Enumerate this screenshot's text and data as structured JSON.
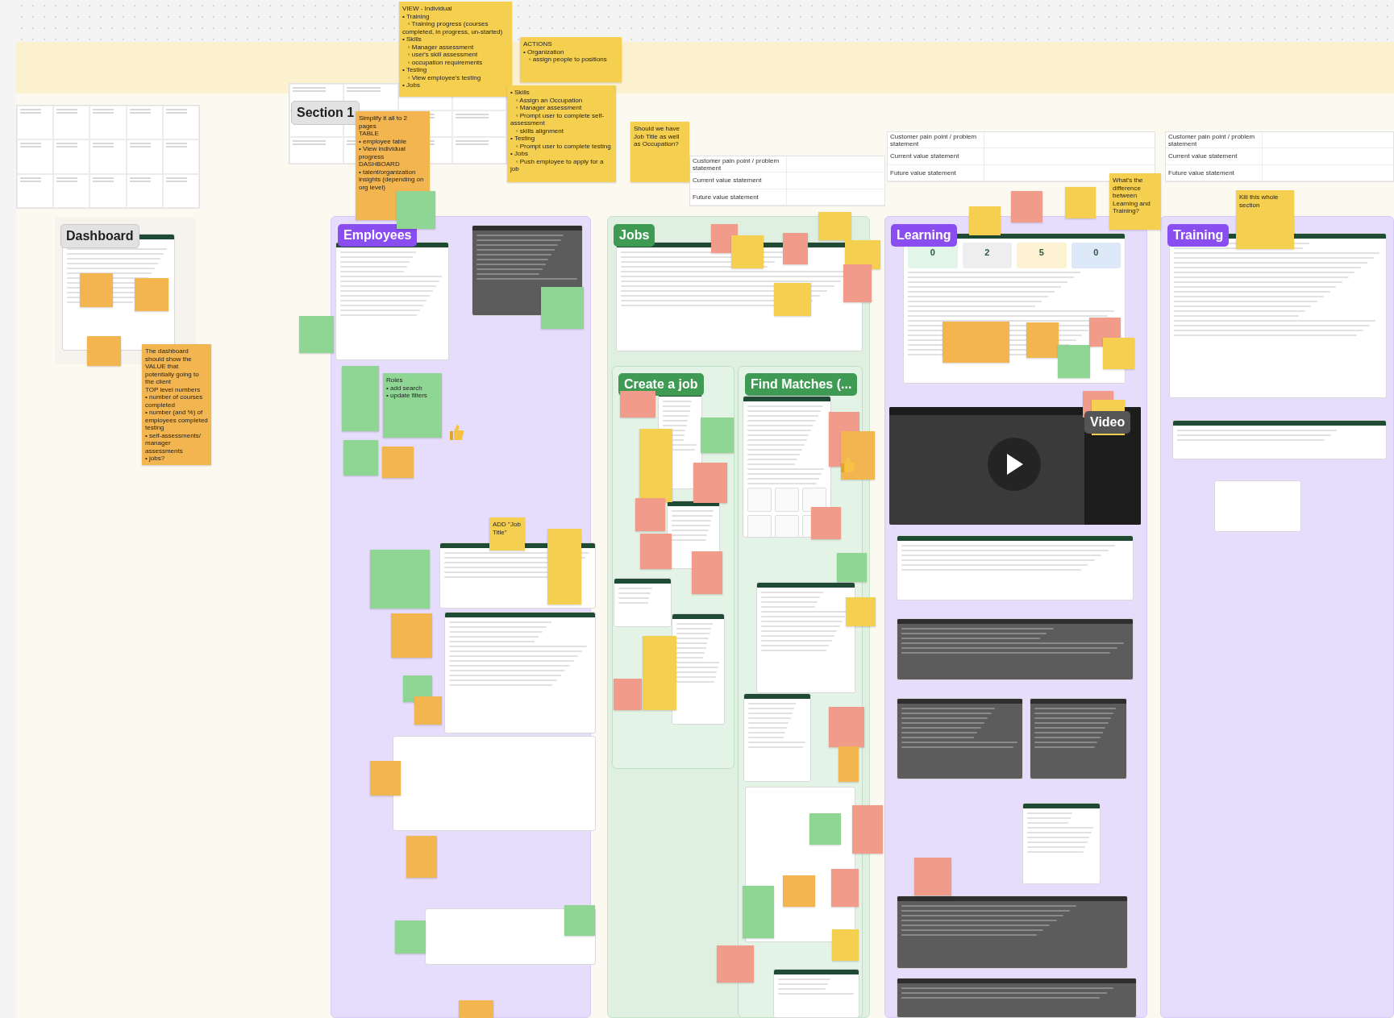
{
  "sections": [
    {
      "label": "Section 1",
      "kind": "grey"
    },
    {
      "label": "Dashboard",
      "kind": "grey"
    },
    {
      "label": "Employees",
      "kind": "purple"
    },
    {
      "label": "Jobs",
      "kind": "green"
    },
    {
      "label": "Create a job",
      "kind": "subgreen"
    },
    {
      "label": "Find Matches (...",
      "kind": "subgreen"
    },
    {
      "label": "Learning",
      "kind": "purple"
    },
    {
      "label": "Training",
      "kind": "purple"
    }
  ],
  "value_tables": [
    {
      "rows": [
        "Customer pain point / problem statement",
        "Current value statement",
        "Future value statement"
      ]
    },
    {
      "rows": [
        "Customer pain point / problem statement",
        "Current value statement",
        "Future value statement"
      ]
    },
    {
      "rows": [
        "Customer pain point / problem statement",
        "Current value statement",
        "Future value statement"
      ]
    }
  ],
  "learning_stats": [
    "0",
    "2",
    "5",
    "0"
  ],
  "video": {
    "label": "Video"
  },
  "notes": [
    {
      "color": "#f5cf4f",
      "lines": [
        "VIEW - Individual",
        "• Training",
        "   ◦ Training progress (courses completed, in progress, un-started)",
        "• Skills",
        "   ◦ Manager assessment",
        "   ◦ user's skill assessment",
        "   ◦ occupation requirements",
        "• Testing",
        "   ◦ View employee's testing",
        "• Jobs"
      ]
    },
    {
      "color": "#f5cf4f",
      "lines": [
        "ACTIONS",
        "• Organization",
        "   ◦ assign people to positions"
      ]
    },
    {
      "color": "#f5cf4f",
      "lines": [
        "• Skills",
        "   ◦ Assign an Occupation",
        "   ◦ Manager assessment",
        "   ◦ Prompt user to complete self-assessment",
        "   ◦ skills alignment",
        "• Testing",
        "   ◦ Prompt user to complete testing",
        "• Jobs",
        "   ◦ Push employee to apply for a job"
      ]
    },
    {
      "color": "#f2b54f",
      "lines": [
        "Simplify it all to 2 pages",
        "TABLE",
        "• employee table",
        "• View individual progress",
        "DASHBOARD",
        "• talent/organization insights (depending on org level)"
      ]
    },
    {
      "color": "#f5cf4f",
      "lines": [
        "Should we have Job Title as well as Occupation?"
      ]
    },
    {
      "color": "#f2b54f",
      "lines": [
        "The dashboard should show the VALUE that potentially going to the client",
        "TOP level numbers",
        "• number of courses completed",
        "• number (and %) of employees completed testing",
        "• self-assessments/ manager assessments",
        "• jobs?"
      ]
    },
    {
      "color": "#f2b54f"
    },
    {
      "color": "#f2b54f"
    },
    {
      "color": "#f2b54f"
    },
    {
      "color": "#8fd694"
    },
    {
      "color": "#8fd694"
    },
    {
      "color": "#8fd694",
      "lines": [
        "Roles",
        "• add search",
        "• update filters"
      ]
    },
    {
      "color": "#8fd694"
    },
    {
      "color": "#f2b54f"
    },
    {
      "color": "#8fd694"
    },
    {
      "color": "#8fd694"
    },
    {
      "color": "#8fd694"
    },
    {
      "color": "#f2b54f"
    },
    {
      "color": "#8fd694"
    },
    {
      "color": "#f2b54f"
    },
    {
      "color": "#f2b54f"
    },
    {
      "color": "#f2b54f"
    },
    {
      "color": "#8fd694"
    },
    {
      "color": "#f2b54f"
    },
    {
      "color": "#f5cf4f",
      "lines": [
        "ADD \"Job Title\""
      ]
    },
    {
      "color": "#f5cf4f"
    },
    {
      "color": "#8fd694"
    },
    {
      "color": "#f19b8b"
    },
    {
      "color": "#f5cf4f"
    },
    {
      "color": "#f19b8b"
    },
    {
      "color": "#f5cf4f"
    },
    {
      "color": "#f5cf4f"
    },
    {
      "color": "#f19b8b"
    },
    {
      "color": "#f5cf4f"
    },
    {
      "color": "#f19b8b"
    },
    {
      "color": "#f5cf4f"
    },
    {
      "color": "#8fd694"
    },
    {
      "color": "#f19b8b"
    },
    {
      "color": "#f19b8b"
    },
    {
      "color": "#f19b8b"
    },
    {
      "color": "#f5cf4f"
    },
    {
      "color": "#f19b8b"
    },
    {
      "color": "#f19b8b"
    },
    {
      "color": "#f19b8b"
    },
    {
      "color": "#f2b54f"
    },
    {
      "color": "#f19b8b"
    },
    {
      "color": "#8fd694"
    },
    {
      "color": "#f5cf4f"
    },
    {
      "color": "#f19b8b"
    },
    {
      "color": "#f2b54f"
    },
    {
      "color": "#8fd694"
    },
    {
      "color": "#f19b8b"
    },
    {
      "color": "#f2b54f"
    },
    {
      "color": "#f19b8b"
    },
    {
      "color": "#8fd694"
    },
    {
      "color": "#f19b8b"
    },
    {
      "color": "#f5cf4f"
    },
    {
      "color": "#f5cf4f"
    },
    {
      "color": "#f19b8b"
    },
    {
      "color": "#f5cf4f"
    },
    {
      "color": "#f5cf4f",
      "lines": [
        "What's the difference between Learning and Training?"
      ]
    },
    {
      "color": "#f5cf4f",
      "lines": [
        "Kill this whole section"
      ]
    },
    {
      "color": "#f2b54f"
    },
    {
      "color": "#f2b54f"
    },
    {
      "color": "#8fd694"
    },
    {
      "color": "#f19b8b"
    },
    {
      "color": "#f5cf4f"
    },
    {
      "color": "#f19b8b"
    },
    {
      "color": "#f5cf4f"
    },
    {
      "color": "#f19b8b"
    }
  ]
}
